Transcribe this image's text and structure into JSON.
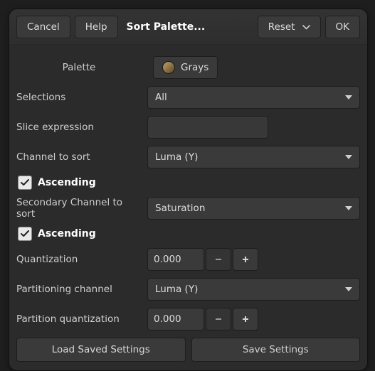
{
  "titlebar": {
    "cancel": "Cancel",
    "help": "Help",
    "title": "Sort Palette...",
    "reset": "Reset",
    "ok": "OK"
  },
  "labels": {
    "palette": "Palette",
    "selections": "Selections",
    "slice": "Slice expression",
    "channel": "Channel to sort",
    "ascending": "Ascending",
    "secondary": "Secondary Channel to sort",
    "quantization": "Quantization",
    "partition_channel": "Partitioning channel",
    "partition_quant": "Partition quantization"
  },
  "values": {
    "palette_name": "Grays",
    "selections": "All",
    "slice": "",
    "channel": "Luma (Y)",
    "secondary": "Saturation",
    "quantization": "0.000",
    "partition_channel": "Luma (Y)",
    "partition_quant": "0.000"
  },
  "footer": {
    "load": "Load Saved Settings",
    "save": "Save Settings"
  }
}
